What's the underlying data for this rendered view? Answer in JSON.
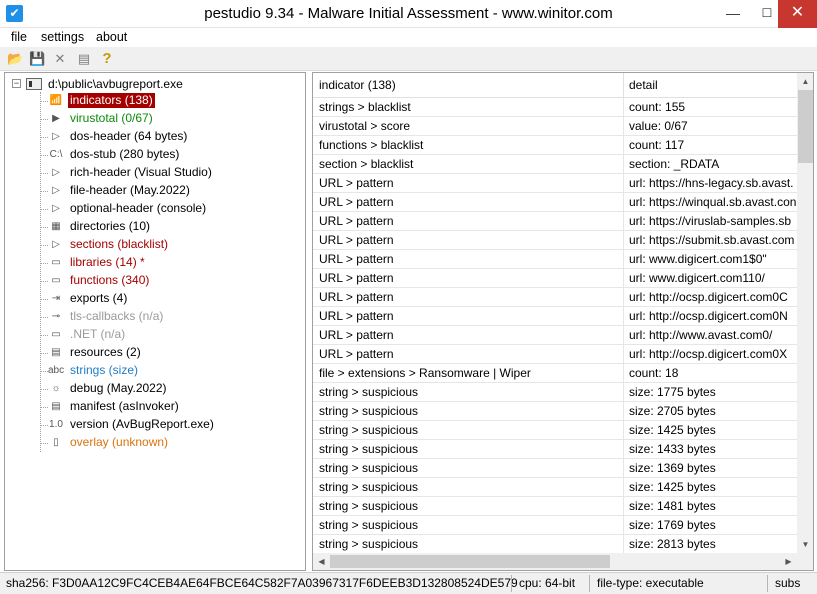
{
  "window": {
    "title": "pestudio 9.34 - Malware Initial Assessment - www.winitor.com",
    "icon": "checkmark-app-icon",
    "controls": {
      "minimize": "—",
      "maximize": "☐",
      "close": "✕"
    }
  },
  "menu": {
    "file": "file",
    "settings": "settings",
    "about": "about"
  },
  "toolbar": {
    "open_icon": "📂",
    "save_icon": "💾",
    "close_icon": "✕",
    "list_icon": "▤",
    "help_icon": "?"
  },
  "tree": {
    "root": "d:\\public\\avbugreport.exe",
    "items": [
      {
        "label": "indicators (138)",
        "icon": "📶",
        "style": "sel"
      },
      {
        "label": "virustotal (0/67)",
        "icon": "▶",
        "style": "green"
      },
      {
        "label": "dos-header (64 bytes)",
        "icon": "▷",
        "style": ""
      },
      {
        "label": "dos-stub (280 bytes)",
        "icon": "C:\\",
        "style": ""
      },
      {
        "label": "rich-header (Visual Studio)",
        "icon": "▷",
        "style": ""
      },
      {
        "label": "file-header (May.2022)",
        "icon": "▷",
        "style": ""
      },
      {
        "label": "optional-header (console)",
        "icon": "▷",
        "style": ""
      },
      {
        "label": "directories (10)",
        "icon": "▦",
        "style": ""
      },
      {
        "label": "sections (blacklist)",
        "icon": "▷",
        "style": "red"
      },
      {
        "label": "libraries (14) *",
        "icon": "▭",
        "style": "red"
      },
      {
        "label": "functions (340)",
        "icon": "▭",
        "style": "red"
      },
      {
        "label": "exports (4)",
        "icon": "⇥",
        "style": ""
      },
      {
        "label": "tls-callbacks (n/a)",
        "icon": "⊸",
        "style": "grey"
      },
      {
        "label": ".NET (n/a)",
        "icon": "▭",
        "style": "grey"
      },
      {
        "label": "resources (2)",
        "icon": "▤",
        "style": ""
      },
      {
        "label": "strings (size)",
        "icon": "abc",
        "style": "blue"
      },
      {
        "label": "debug (May.2022)",
        "icon": "☼",
        "style": ""
      },
      {
        "label": "manifest (asInvoker)",
        "icon": "▤",
        "style": ""
      },
      {
        "label": "version (AvBugReport.exe)",
        "icon": "1.0",
        "style": ""
      },
      {
        "label": "overlay (unknown)",
        "icon": "▯",
        "style": "orange"
      }
    ]
  },
  "list": {
    "headers": {
      "indicator": "indicator (138)",
      "detail": "detail"
    },
    "rows": [
      {
        "indicator": "strings > blacklist",
        "detail": "count: 155"
      },
      {
        "indicator": "virustotal > score",
        "detail": "value: 0/67"
      },
      {
        "indicator": "functions > blacklist",
        "detail": "count: 117"
      },
      {
        "indicator": "section > blacklist",
        "detail": "section: _RDATA"
      },
      {
        "indicator": "URL > pattern",
        "detail": "url: https://hns-legacy.sb.avast."
      },
      {
        "indicator": "URL > pattern",
        "detail": "url: https://winqual.sb.avast.con"
      },
      {
        "indicator": "URL > pattern",
        "detail": "url: https://viruslab-samples.sb"
      },
      {
        "indicator": "URL > pattern",
        "detail": "url: https://submit.sb.avast.com"
      },
      {
        "indicator": "URL > pattern",
        "detail": "url: www.digicert.com1$0\""
      },
      {
        "indicator": "URL > pattern",
        "detail": "url: www.digicert.com110/"
      },
      {
        "indicator": "URL > pattern",
        "detail": "url: http://ocsp.digicert.com0C"
      },
      {
        "indicator": "URL > pattern",
        "detail": "url: http://ocsp.digicert.com0N"
      },
      {
        "indicator": "URL > pattern",
        "detail": "url: http://www.avast.com0/"
      },
      {
        "indicator": "URL > pattern",
        "detail": "url: http://ocsp.digicert.com0X"
      },
      {
        "indicator": "file > extensions > Ransomware | Wiper",
        "detail": "count: 18"
      },
      {
        "indicator": "string > suspicious",
        "detail": "size: 1775 bytes"
      },
      {
        "indicator": "string > suspicious",
        "detail": "size: 2705 bytes"
      },
      {
        "indicator": "string > suspicious",
        "detail": "size: 1425 bytes"
      },
      {
        "indicator": "string > suspicious",
        "detail": "size: 1433 bytes"
      },
      {
        "indicator": "string > suspicious",
        "detail": "size: 1369 bytes"
      },
      {
        "indicator": "string > suspicious",
        "detail": "size: 1425 bytes"
      },
      {
        "indicator": "string > suspicious",
        "detail": "size: 1481 bytes"
      },
      {
        "indicator": "string > suspicious",
        "detail": "size: 1769 bytes"
      },
      {
        "indicator": "string > suspicious",
        "detail": "size: 2813 bytes"
      }
    ]
  },
  "status": {
    "sha256": "sha256: F3D0AA12C9FC4CEB4AE64FBCE64C582F7A03967317F6DEEB3D132808524DE579",
    "cpu": "cpu: 64-bit",
    "file_type": "file-type: executable",
    "subsystem": "subs"
  }
}
